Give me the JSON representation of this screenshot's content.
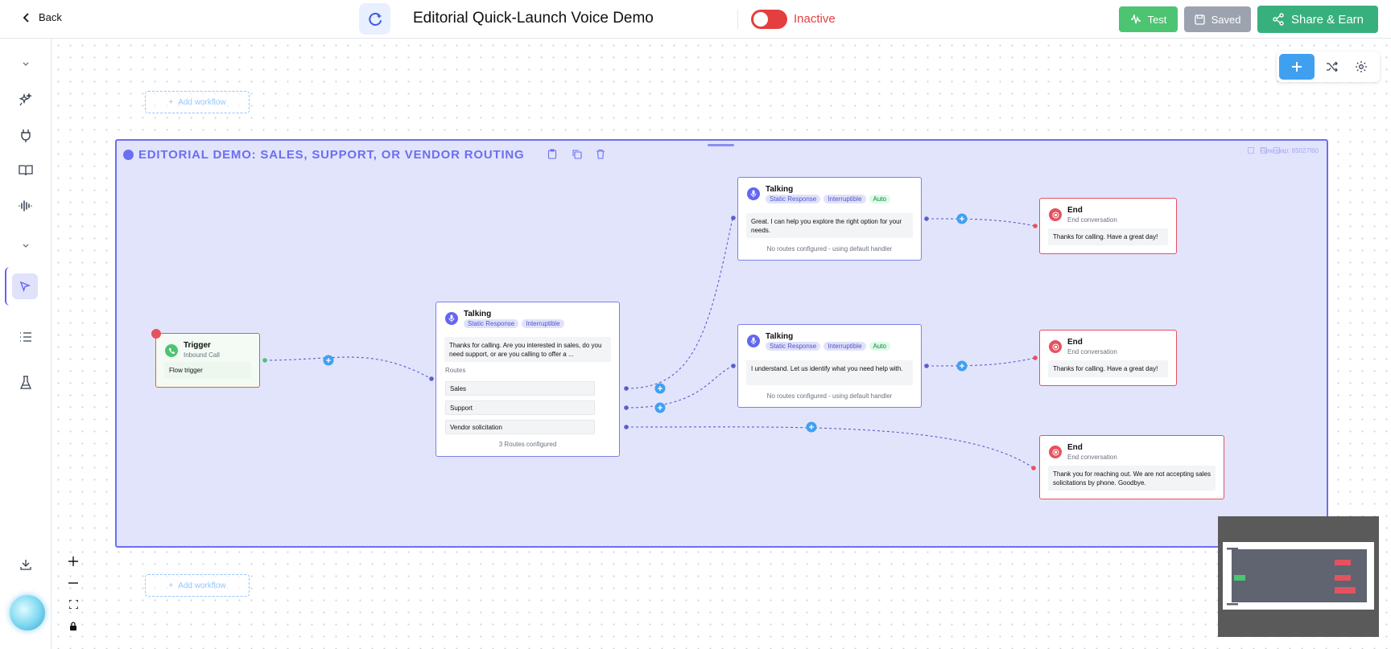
{
  "header": {
    "back_label": "Back",
    "title": "Editorial Quick-Launch Voice Demo",
    "status": "Inactive",
    "test_label": "Test",
    "saved_label": "Saved",
    "share_label": "Share & Earn"
  },
  "canvas": {
    "add_workflow_label": "Add workflow",
    "group": {
      "title": "EDITORIAL DEMO: SALES, SUPPORT, OR VENDOR ROUTING",
      "flow_id": "Flow-map: 85027f60"
    },
    "trigger": {
      "title": "Trigger",
      "subtitle": "Inbound Call",
      "body": "Flow trigger"
    },
    "talking_main": {
      "title": "Talking",
      "tag1": "Static Response",
      "tag2": "Interruptible",
      "message": "Thanks for calling. Are you interested in sales, do you need support, or are you calling to offer a ...",
      "routes_label": "Routes",
      "routes": [
        "Sales",
        "Support",
        "Vendor solicitation"
      ],
      "footer": "3 Routes configured"
    },
    "talking_sales": {
      "title": "Talking",
      "tag1": "Static Response",
      "tag2": "Interruptible",
      "tag3": "Auto",
      "message": "Great. I can help you explore the right option for your needs.",
      "footer": "No routes configured - using default handler"
    },
    "talking_support": {
      "title": "Talking",
      "tag1": "Static Response",
      "tag2": "Interruptible",
      "tag3": "Auto",
      "message": "I understand. Let us identify what you need help with.",
      "footer": "No routes configured - using default handler"
    },
    "end1": {
      "title": "End",
      "subtitle": "End conversation",
      "message": "Thanks for calling. Have a great day!"
    },
    "end2": {
      "title": "End",
      "subtitle": "End conversation",
      "message": "Thanks for calling. Have a great day!"
    },
    "end3": {
      "title": "End",
      "subtitle": "End conversation",
      "message": "Thank you for reaching out. We are not accepting sales solicitations by phone. Goodbye."
    }
  },
  "colors": {
    "accent": "#6b6ff0",
    "inactive": "#e53e3e",
    "test_green": "#4cc471",
    "share_green": "#38b07d",
    "add_blue": "#3fa0f0"
  },
  "icons": [
    "chevron-left-icon",
    "sparkle-icon",
    "waveform-icon",
    "save-icon",
    "share-icon",
    "plus-icon",
    "shuffle-icon",
    "gear-icon",
    "phone-icon",
    "mic-icon",
    "stop-icon",
    "clipboard-icon",
    "copy-icon",
    "trash-icon",
    "download-icon",
    "lock-icon",
    "fullscreen-icon",
    "cursor-icon",
    "list-icon",
    "flask-icon",
    "plug-icon",
    "book-icon",
    "audio-icon"
  ]
}
